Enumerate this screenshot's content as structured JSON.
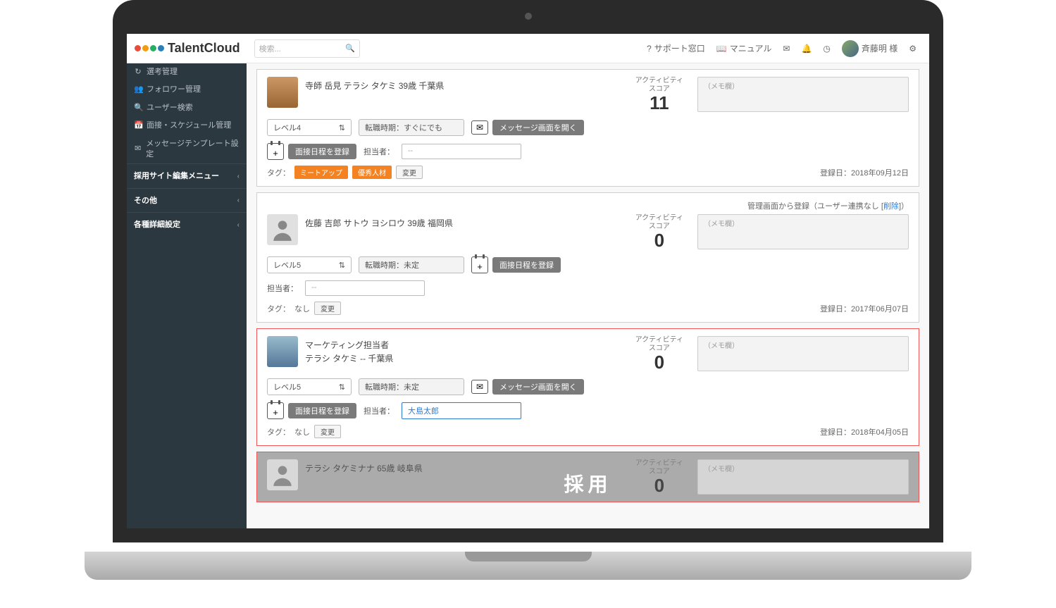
{
  "brand": "TalentCloud",
  "search": {
    "placeholder": "検索..."
  },
  "topnav": {
    "support": "サポート窓口",
    "manual": "マニュアル",
    "username": "斉藤明 様"
  },
  "sidebar": {
    "items": [
      {
        "icon": "↻",
        "label": "選考管理"
      },
      {
        "icon": "👥",
        "label": "フォロワー管理"
      },
      {
        "icon": "🔍",
        "label": "ユーザー検索"
      },
      {
        "icon": "📅",
        "label": "面接・スケジュール管理"
      },
      {
        "icon": "✉",
        "label": "メッセージテンプレート設定"
      }
    ],
    "sections": [
      "採用サイト編集メニュー",
      "その他",
      "各種詳細設定"
    ]
  },
  "common": {
    "activity_label1": "アクティビティ",
    "activity_label2": "スコア",
    "memo_placeholder": "（メモ欄）",
    "open_message": "メッセージ画面を開く",
    "register_interview": "面接日程を登録",
    "assignee_label": "担当者：",
    "tags_label": "タグ：",
    "change_btn": "変更",
    "none": "なし",
    "reg_date_label": "登録日：",
    "admin_reg_prefix": "管理画面から登録（ユーザー連携なし [",
    "admin_reg_delete": "削除",
    "admin_reg_suffix": "]）",
    "transfer_prefix": "転職時期："
  },
  "candidates": [
    {
      "name": "寺師 岳見 テラシ タケミ 39歳 千葉県",
      "score": "11",
      "level": "レベル4",
      "transfer": "すぐにでも",
      "assignee": "--",
      "tags": [
        "ミートアップ",
        "優秀人材"
      ],
      "reg_date": "2018年09月12日"
    },
    {
      "admin_reg": true,
      "name": "佐藤 吉郎 サトウ ヨシロウ 39歳 福岡県",
      "score": "0",
      "level": "レベル5",
      "transfer": "未定",
      "assignee": "--",
      "tags_none": true,
      "reg_date": "2017年06月07日"
    },
    {
      "highlight": true,
      "title": "マーケティング担当者",
      "name": "テラシ タケミ -- 千葉県",
      "score": "0",
      "level": "レベル5",
      "transfer": "未定",
      "assignee": "大島太郎",
      "tags_none": true,
      "reg_date": "2018年04月05日"
    }
  ],
  "overlay": {
    "name": "テラシ タケミナナ 65歳 岐阜県",
    "score": "0",
    "label": "採用"
  }
}
